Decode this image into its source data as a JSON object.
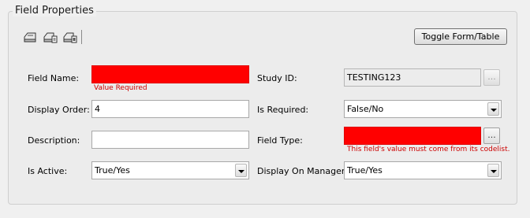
{
  "panel": {
    "title": "Field Properties"
  },
  "toolbar": {
    "icons": [
      "save-icon",
      "save-as-icon",
      "save-close-icon"
    ],
    "toggle_label": "Toggle Form/Table"
  },
  "form": {
    "field_name": {
      "label": "Field Name:",
      "value": "",
      "error": "Value Required"
    },
    "study_id": {
      "label": "Study ID:",
      "value": "TESTING123",
      "button": "..."
    },
    "display_order": {
      "label": "Display Order:",
      "value": "4"
    },
    "is_required": {
      "label": "Is Required:",
      "value": "False/No"
    },
    "description": {
      "label": "Description:",
      "value": ""
    },
    "field_type": {
      "label": "Field Type:",
      "value": "",
      "button": "...",
      "error": "This field's value must come from its codelist."
    },
    "is_active": {
      "label": "Is Active:",
      "value": "True/Yes"
    },
    "display_on_manager": {
      "label": "Display On Manager:",
      "value": "True/Yes"
    }
  },
  "colors": {
    "error_fill": "#ff0000",
    "error_text": "#cc0000"
  }
}
